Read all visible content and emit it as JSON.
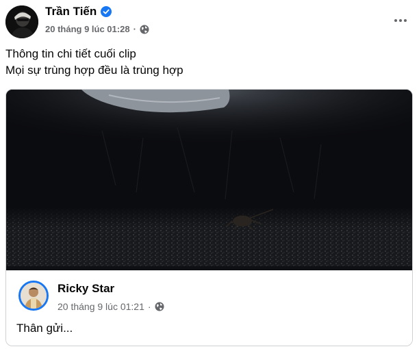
{
  "post": {
    "author": "Trần Tiến",
    "timestamp": "20 tháng 9 lúc 01:28",
    "separator": "·",
    "privacy_icon": "globe-icon",
    "verified_icon": "verified-badge-icon",
    "more_icon": "more-options-icon",
    "text_lines": [
      "Thông tin chi tiết cuối clip",
      "Mọi sự trùng hợp đều là trùng hợp"
    ]
  },
  "shared": {
    "author": "Ricky Star",
    "timestamp": "20 tháng 9 lúc 01:21",
    "separator": "·",
    "privacy_icon": "globe-icon",
    "text": "Thân gửi..."
  },
  "colors": {
    "accent": "#1877f2",
    "secondary_text": "#65676b",
    "primary_text": "#050505",
    "card_border": "#ced0d4"
  }
}
